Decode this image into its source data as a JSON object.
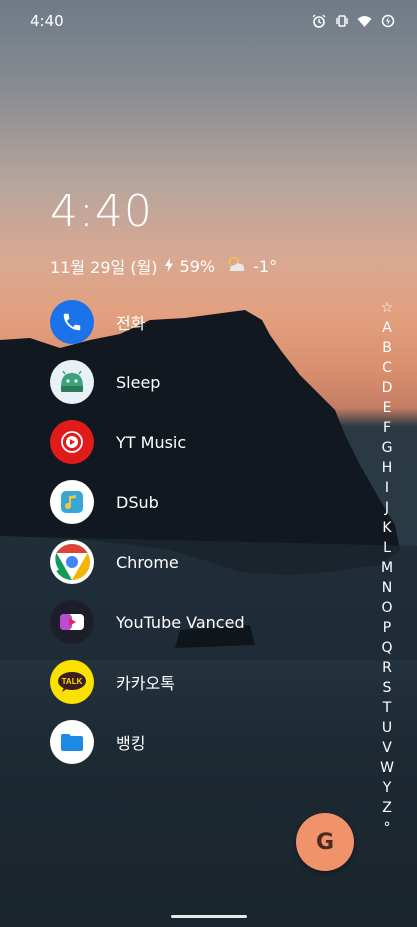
{
  "status_bar": {
    "time": "4:40"
  },
  "widget": {
    "time": "4:40",
    "date": "11월 29일 (월)",
    "battery": "59%",
    "temperature": "-1°"
  },
  "apps": [
    {
      "label": "전화",
      "icon": "phone-icon",
      "color": "#1a73e8"
    },
    {
      "label": "Sleep",
      "icon": "sleep-icon",
      "color": "#e8f1f5"
    },
    {
      "label": "YT Music",
      "icon": "yt-music-icon",
      "color": "#e11b1b"
    },
    {
      "label": "DSub",
      "icon": "dsub-icon",
      "color": "#ffffff"
    },
    {
      "label": "Chrome",
      "icon": "chrome-icon",
      "color": "#ffffff"
    },
    {
      "label": "YouTube Vanced",
      "icon": "youtube-vanced-icon",
      "color": "#1e1e2a"
    },
    {
      "label": "카카오톡",
      "icon": "kakaotalk-icon",
      "color": "#fae100"
    },
    {
      "label": "뱅킹",
      "icon": "banking-icon",
      "color": "#ffffff"
    }
  ],
  "alphabet": [
    "☆",
    "A",
    "B",
    "C",
    "D",
    "E",
    "F",
    "G",
    "H",
    "I",
    "J",
    "K",
    "L",
    "M",
    "N",
    "O",
    "P",
    "Q",
    "R",
    "S",
    "T",
    "U",
    "V",
    "W",
    "Y",
    "Z",
    "°"
  ],
  "fab": {
    "label": "G"
  }
}
